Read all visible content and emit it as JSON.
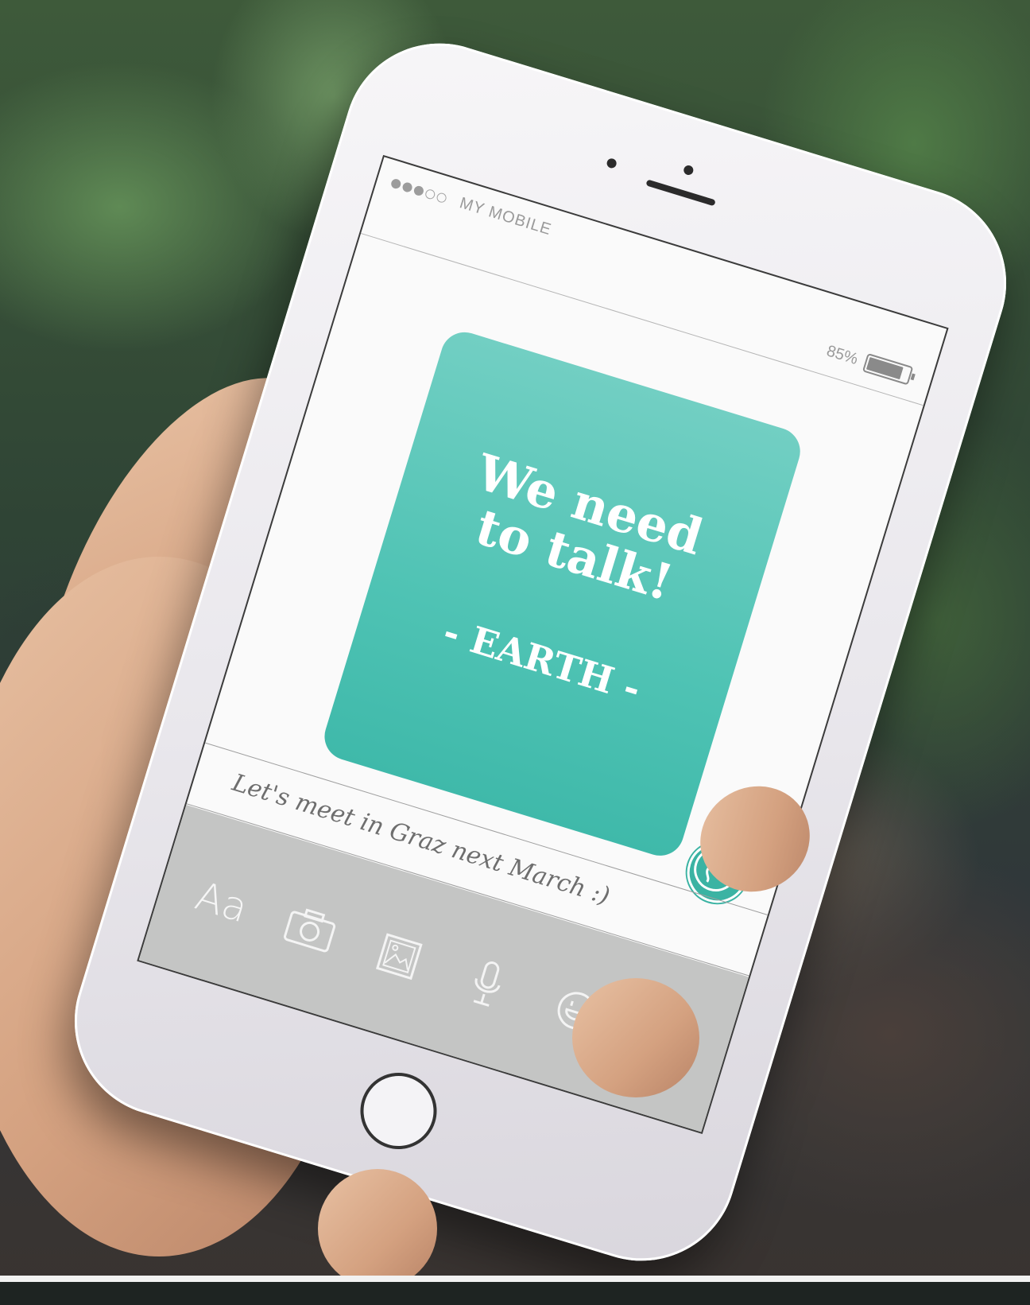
{
  "status_bar": {
    "carrier": "MY MOBILE",
    "signal_strength": 3,
    "signal_max": 5,
    "battery_label": "85%",
    "battery_level": 0.85
  },
  "card": {
    "headline_line1": "We need",
    "headline_line2": "to talk!",
    "signoff": "- EARTH -",
    "color": "#4fc3b4"
  },
  "message": {
    "text": "Let's meet in Graz next March :)",
    "avatar_icon": "globe-icon"
  },
  "toolbar": {
    "text_tool_label": "Aa",
    "icons": [
      "camera-icon",
      "image-icon",
      "microphone-icon",
      "emoji-icon",
      "send-icon"
    ]
  }
}
